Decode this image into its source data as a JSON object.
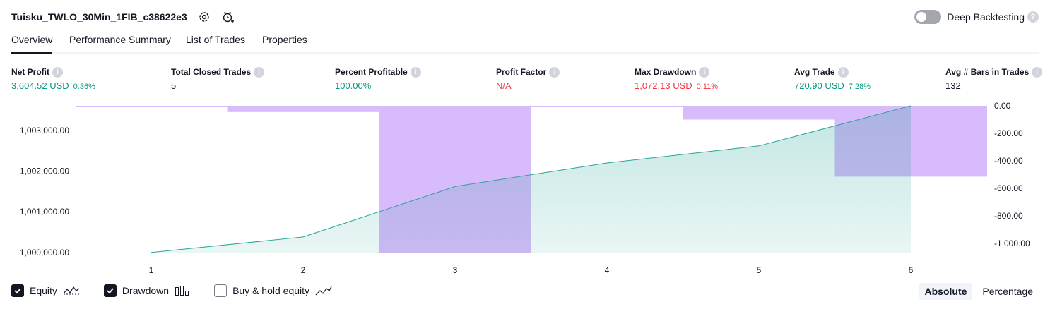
{
  "header": {
    "title": "Tuisku_TWLO_30Min_1FIB_c38622e3",
    "settings_icon": "gear-icon",
    "alert_icon": "add-alert-icon"
  },
  "deep_backtesting": {
    "label": "Deep Backtesting",
    "enabled": false,
    "help_glyph": "?"
  },
  "tabs": [
    {
      "label": "Overview",
      "active": true
    },
    {
      "label": "Performance Summary",
      "active": false
    },
    {
      "label": "List of Trades",
      "active": false
    },
    {
      "label": "Properties",
      "active": false
    }
  ],
  "metrics": [
    {
      "label": "Net Profit",
      "value": "3,604.52 USD",
      "pct": "0.36%",
      "color": "#089981"
    },
    {
      "label": "Total Closed Trades",
      "value": "5",
      "pct": "",
      "color": "#131722"
    },
    {
      "label": "Percent Profitable",
      "value": "100.00%",
      "pct": "",
      "color": "#089981"
    },
    {
      "label": "Profit Factor",
      "value": "N/A",
      "pct": "",
      "color": "#f23645"
    },
    {
      "label": "Max Drawdown",
      "value": "1,072.13 USD",
      "pct": "0.11%",
      "color": "#f23645"
    },
    {
      "label": "Avg Trade",
      "value": "720.90 USD",
      "pct": "7.28%",
      "color": "#089981"
    },
    {
      "label": "Avg # Bars in Trades",
      "value": "132",
      "pct": "",
      "color": "#131722"
    }
  ],
  "chart_data": {
    "type": "area",
    "x": [
      1,
      2,
      3,
      4,
      5,
      6
    ],
    "xlim": [
      0.6,
      6.5
    ],
    "series": [
      {
        "name": "Equity",
        "axis": "left",
        "values": [
          1000000,
          1000380,
          1001620,
          1002200,
          1002620,
          1003604.52
        ],
        "color": "#26a69a"
      },
      {
        "name": "Drawdown",
        "axis": "right",
        "type": "bar",
        "x": [
          1,
          2,
          3,
          4,
          5,
          6
        ],
        "values": [
          -5,
          -45,
          -1072.13,
          -5,
          -100,
          -515
        ],
        "color": "#e1c4fc"
      }
    ],
    "left_axis": {
      "ticks": [
        1000000,
        1001000,
        1002000,
        1003000
      ],
      "tick_labels": [
        "1,000,000.00",
        "1,001,000.00",
        "1,002,000.00",
        "1,003,000.00"
      ],
      "ylim": [
        999980,
        1003604.52
      ]
    },
    "right_axis": {
      "ticks": [
        0,
        -200,
        -400,
        -600,
        -800,
        -1000
      ],
      "tick_labels": [
        "0.00",
        "-200.00",
        "-400.00",
        "-600.00",
        "-800.00",
        "-1,000.00"
      ],
      "ylim": [
        -1072.13,
        0
      ]
    },
    "x_tick_labels": [
      "1",
      "2",
      "3",
      "4",
      "5",
      "6"
    ],
    "grid": false
  },
  "legend": [
    {
      "label": "Equity",
      "checked": true,
      "icon": "equity-line-icon"
    },
    {
      "label": "Drawdown",
      "checked": true,
      "icon": "drawdown-bars-icon"
    },
    {
      "label": "Buy & hold equity",
      "checked": false,
      "icon": "buy-hold-line-icon"
    }
  ],
  "modes": [
    {
      "label": "Absolute",
      "active": true
    },
    {
      "label": "Percentage",
      "active": false
    }
  ]
}
